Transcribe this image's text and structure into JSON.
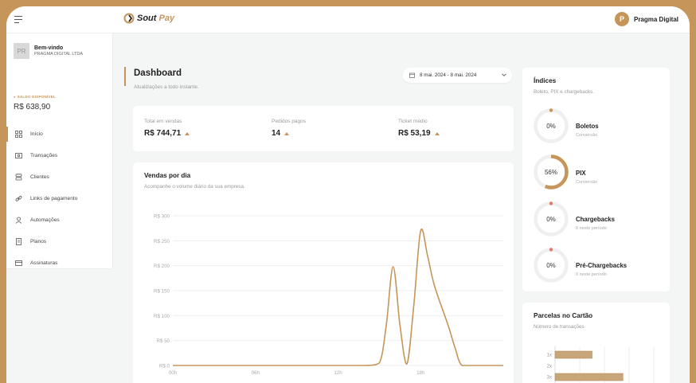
{
  "brand": {
    "name_part1": "Sout",
    "name_part2": "Pay",
    "accent": "#c5955a"
  },
  "user": {
    "initial": "P",
    "name": "Pragma Digital"
  },
  "sidebar": {
    "profile": {
      "avatar_initials": "PR",
      "welcome": "Bem-vindo",
      "company": "PRAGMA DIGITAL LTDA"
    },
    "balance": {
      "label": "SALDO DISPONÍVEL",
      "value": "R$ 638,90"
    },
    "items": [
      {
        "label": "Início",
        "icon": "grid-icon",
        "active": true
      },
      {
        "label": "Transações",
        "icon": "money-icon",
        "active": false
      },
      {
        "label": "Clientes",
        "icon": "users-icon",
        "active": false
      },
      {
        "label": "Links de pagamento",
        "icon": "link-icon",
        "active": false
      },
      {
        "label": "Automações",
        "icon": "automation-icon",
        "active": false
      },
      {
        "label": "Planos",
        "icon": "document-icon",
        "active": false
      },
      {
        "label": "Assinaturas",
        "icon": "subscription-icon",
        "active": false
      }
    ]
  },
  "page": {
    "title": "Dashboard",
    "subtitle": "Atualizações a todo instante."
  },
  "date_range": {
    "value": "8 mai. 2024 - 8 mai. 2024"
  },
  "stats": [
    {
      "label": "Total em vendas",
      "value": "R$ 744,71"
    },
    {
      "label": "Pedidos pagos",
      "value": "14"
    },
    {
      "label": "Ticket médio",
      "value": "R$ 53,19"
    }
  ],
  "sales_chart": {
    "title": "Vendas por dia",
    "subtitle": "Acompanhe o volume diário da sua empresa."
  },
  "chart_data": [
    {
      "type": "line",
      "title": "Vendas por dia",
      "y_tick_labels": [
        "R$ 300",
        "R$ 250",
        "R$ 200",
        "R$ 150",
        "R$ 100",
        "R$ 50",
        "R$ 0"
      ],
      "ylim": [
        0,
        300
      ],
      "x_tick_labels": [
        "00h",
        "06h",
        "12h",
        "18h"
      ],
      "grid": true,
      "series": [
        {
          "color": "#c5955a",
          "x": [
            0,
            2,
            4,
            6,
            8,
            10,
            12,
            14,
            15,
            15.5,
            16,
            16.5,
            17,
            17.5,
            18,
            18.5,
            19,
            20,
            20.5,
            21,
            22,
            23,
            24
          ],
          "values": [
            0,
            0,
            0,
            0,
            0,
            0,
            0,
            0,
            5,
            80,
            198,
            80,
            3,
            120,
            270,
            220,
            160,
            80,
            35,
            0,
            0,
            0,
            0
          ]
        }
      ]
    },
    {
      "type": "bar",
      "title": "Parcelas no Cartão",
      "categories": [
        "1x",
        "2x",
        "3x"
      ],
      "values": [
        6,
        0,
        11
      ]
    }
  ],
  "indices": {
    "title": "Índices",
    "subtitle": "Boleto, PIX e chargebacks.",
    "items": [
      {
        "value_label": "0%",
        "percent": 0,
        "title": "Boletos",
        "subtitle": "Conversão",
        "color": "#c5955a"
      },
      {
        "value_label": "56%",
        "percent": 56,
        "title": "PIX",
        "subtitle": "Conversão",
        "color": "#c5955a"
      },
      {
        "value_label": "0%",
        "percent": 0,
        "title": "Chargebacks",
        "subtitle": "0 neste período",
        "color": "#e57a6a"
      },
      {
        "value_label": "0%",
        "percent": 0,
        "title": "Pré-Chargebacks",
        "subtitle": "0 neste período",
        "color": "#e57a6a"
      }
    ]
  },
  "parcelas": {
    "title": "Parcelas no Cartão",
    "subtitle": "Número de transações"
  }
}
